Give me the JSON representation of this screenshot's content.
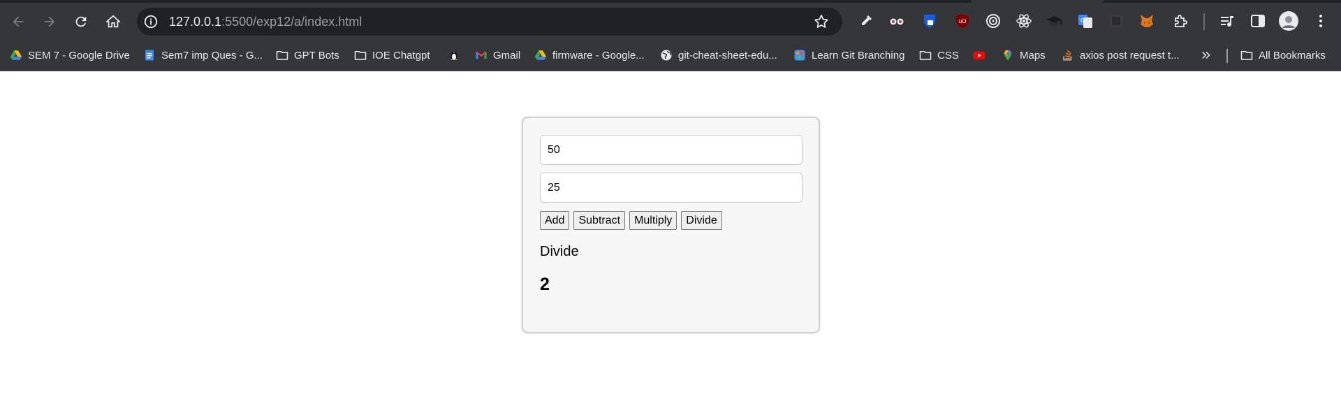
{
  "browser": {
    "url_host": "127.0.0.1",
    "url_rest": ":5500/exp12/a/index.html"
  },
  "bookmarks": [
    {
      "label": "SEM 7 - Google Drive",
      "icon": "google-drive-icon"
    },
    {
      "label": "Sem7 imp Ques - G...",
      "icon": "google-docs-icon"
    },
    {
      "label": "GPT Bots",
      "icon": "folder-icon"
    },
    {
      "label": "IOE Chatgpt",
      "icon": "folder-icon"
    },
    {
      "label": "",
      "icon": "linux-penguin-icon"
    },
    {
      "label": "Gmail",
      "icon": "gmail-icon"
    },
    {
      "label": "firmware - Google...",
      "icon": "google-drive-icon"
    },
    {
      "label": "git-cheat-sheet-edu...",
      "icon": "globe-icon"
    },
    {
      "label": "Learn Git Branching",
      "icon": "git-branching-icon"
    },
    {
      "label": "CSS",
      "icon": "folder-icon"
    },
    {
      "label": "",
      "icon": "youtube-icon"
    },
    {
      "label": "Maps",
      "icon": "google-maps-icon"
    },
    {
      "label": "axios post request t...",
      "icon": "stackoverflow-icon"
    }
  ],
  "all_bookmarks_label": "All Bookmarks",
  "calculator": {
    "input1_value": "50",
    "input2_value": "25",
    "buttons": {
      "add": "Add",
      "subtract": "Subtract",
      "multiply": "Multiply",
      "divide": "Divide"
    },
    "operation_label": "Divide",
    "result": "2"
  }
}
